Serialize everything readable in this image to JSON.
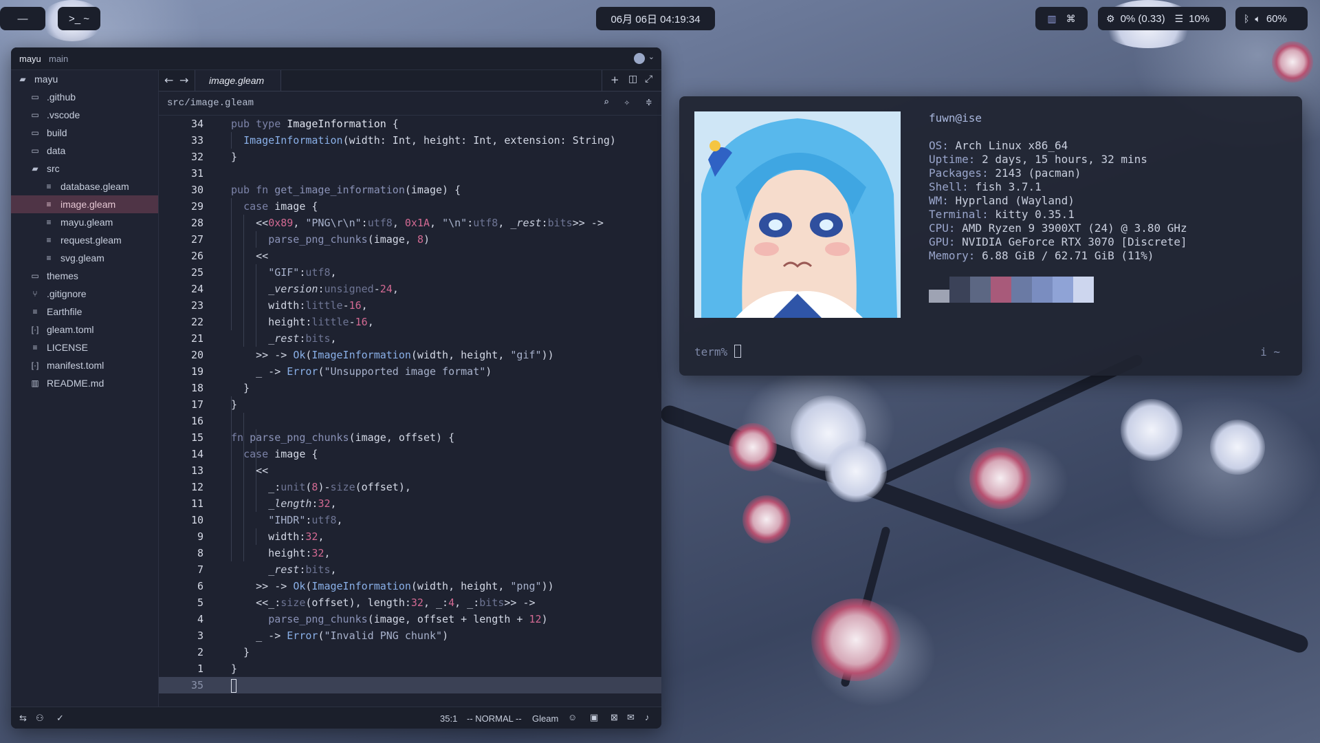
{
  "topbar": {
    "left_pill1": "—",
    "left_pill2": ">_ ~",
    "clock": "06月 06日 04:19:34",
    "cpu": "0% (0.33)",
    "mem": "10%",
    "volume": "60%"
  },
  "editor": {
    "title_project": "mayu",
    "title_branch": "main",
    "tab": "image.gleam",
    "path": "src/image.gleam",
    "tree": [
      {
        "label": "mayu",
        "icon": "folder-open-icon"
      },
      {
        "label": ".github",
        "icon": "folder-icon"
      },
      {
        "label": ".vscode",
        "icon": "folder-icon"
      },
      {
        "label": "build",
        "icon": "folder-icon"
      },
      {
        "label": "data",
        "icon": "folder-icon"
      },
      {
        "label": "src",
        "icon": "folder-open-icon"
      },
      {
        "label": "database.gleam",
        "icon": "file-icon"
      },
      {
        "label": "image.gleam",
        "icon": "file-icon"
      },
      {
        "label": "mayu.gleam",
        "icon": "file-icon"
      },
      {
        "label": "request.gleam",
        "icon": "file-icon"
      },
      {
        "label": "svg.gleam",
        "icon": "file-icon"
      },
      {
        "label": "themes",
        "icon": "folder-icon"
      },
      {
        "label": ".gitignore",
        "icon": "git-icon"
      },
      {
        "label": "Earthfile",
        "icon": "file-icon"
      },
      {
        "label": "gleam.toml",
        "icon": "toml-icon"
      },
      {
        "label": "LICENSE",
        "icon": "file-icon"
      },
      {
        "label": "manifest.toml",
        "icon": "toml-icon"
      },
      {
        "label": "README.md",
        "icon": "book-icon"
      }
    ],
    "line_numbers": [
      "34",
      "33",
      "32",
      "31",
      "30",
      "29",
      "28",
      "27",
      "26",
      "25",
      "24",
      "23",
      "22",
      "21",
      "20",
      "19",
      "18",
      "17",
      "16",
      "15",
      "14",
      "13",
      "12",
      "11",
      "10",
      "9",
      "8",
      "7",
      "6",
      "5",
      "4",
      "3",
      "2",
      "1",
      "35"
    ],
    "status": {
      "position": "35:1",
      "mode": "-- NORMAL --",
      "language": "Gleam"
    }
  },
  "terminal": {
    "user_host": "fuwn@ise",
    "info": [
      {
        "label": "OS",
        "value": "Arch Linux x86_64"
      },
      {
        "label": "Uptime",
        "value": "2 days, 15 hours, 32 mins"
      },
      {
        "label": "Packages",
        "value": "2143 (pacman)"
      },
      {
        "label": "Shell",
        "value": "fish 3.7.1"
      },
      {
        "label": "WM",
        "value": "Hyprland (Wayland)"
      },
      {
        "label": "Terminal",
        "value": "kitty 0.35.1"
      },
      {
        "label": "CPU",
        "value": "AMD Ryzen 9 3900XT (24) @ 3.80 GHz"
      },
      {
        "label": "GPU",
        "value": "NVIDIA GeForce RTX 3070 [Discrete]"
      },
      {
        "label": "Memory",
        "value": "6.88 GiB / 62.71 GiB (11%)"
      }
    ],
    "palette": [
      "#9ea3b3",
      "#3b4258",
      "#5c6783",
      "#a85a7a",
      "#6a7aa4",
      "#7a8dc0",
      "#8fa3d6",
      "#cdd6ee"
    ],
    "prompt": "term%",
    "right_prompt": "i ~"
  }
}
